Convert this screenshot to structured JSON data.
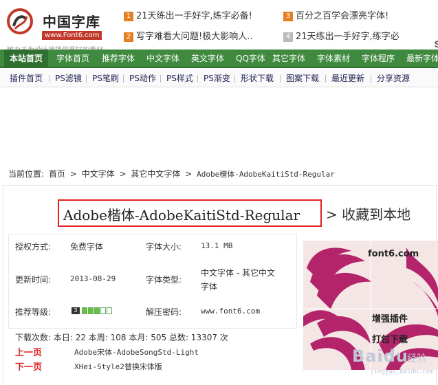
{
  "header": {
    "logo_name": "中国字库",
    "logo_url": "www.Font6.com",
    "tagline": "致力于为设计师提供最好的素材",
    "news": [
      {
        "num": "1",
        "text": "21天练出一手好字,练字必备!"
      },
      {
        "num": "3",
        "text": "百分之百学会漂亮字体!"
      },
      {
        "num": "2",
        "text": "写字难看大问题!极大影响人.."
      },
      {
        "num": "4",
        "text": "21天练出一手好字,练字必"
      }
    ],
    "cut_letter": "S"
  },
  "nav": [
    "本站首页",
    "字体首页",
    "推荐字体",
    "中文字体",
    "英文字体",
    "QQ字体",
    "其它字体",
    "字体素材",
    "字体程序",
    "最新字体"
  ],
  "subnav": [
    "插件首页",
    "PS滤镜",
    "PS笔刷",
    "PS动作",
    "PS样式",
    "PS渐变",
    "形状下载",
    "图案下载",
    "最近更新",
    "分享资源"
  ],
  "breadcrumb": [
    "当前位置:",
    "首页",
    ">",
    "中文字体",
    ">",
    "其它中文字体",
    ">",
    "Adobe楷体-AdobeKaitiStd-Regular"
  ],
  "title": "Adobe楷体-AdobeKaitiStd-Regular",
  "collect": "> 收藏到本地",
  "info": {
    "license_label": "授权方式:",
    "license": "免费字体",
    "size_label": "字体大小:",
    "size": "13.1 MB",
    "updated_label": "更新时间:",
    "updated": "2013-08-29",
    "type_label": "字体类型:",
    "type_line1": "中文字体 - 其它中文",
    "type_line2": "字体",
    "level_label": "推荐等级:",
    "level_badge": "3",
    "level_value": 3,
    "level_max": 5,
    "password_label": "解压密码:",
    "password": "www.font6.com",
    "downloads": "下载次数: 本日: 22 本周: 108 本月: 505 总数: 13307 次",
    "prev_label": "上一页",
    "prev": "Adobe宋体-AdobeSongStd-Light",
    "next_label": "下一页",
    "next": "XHei-Style2替换宋体版"
  },
  "preview": {
    "site": "font6.com",
    "plugin": "增强插件",
    "pack": "打包下载"
  },
  "watermark": {
    "brand": "Baidu",
    "sub": "经验",
    "url": "jingyan.baidu.com"
  },
  "colors": {
    "nav_green": "#3f8a3f",
    "accent_red": "#e02020",
    "flower": "#b3246a"
  }
}
